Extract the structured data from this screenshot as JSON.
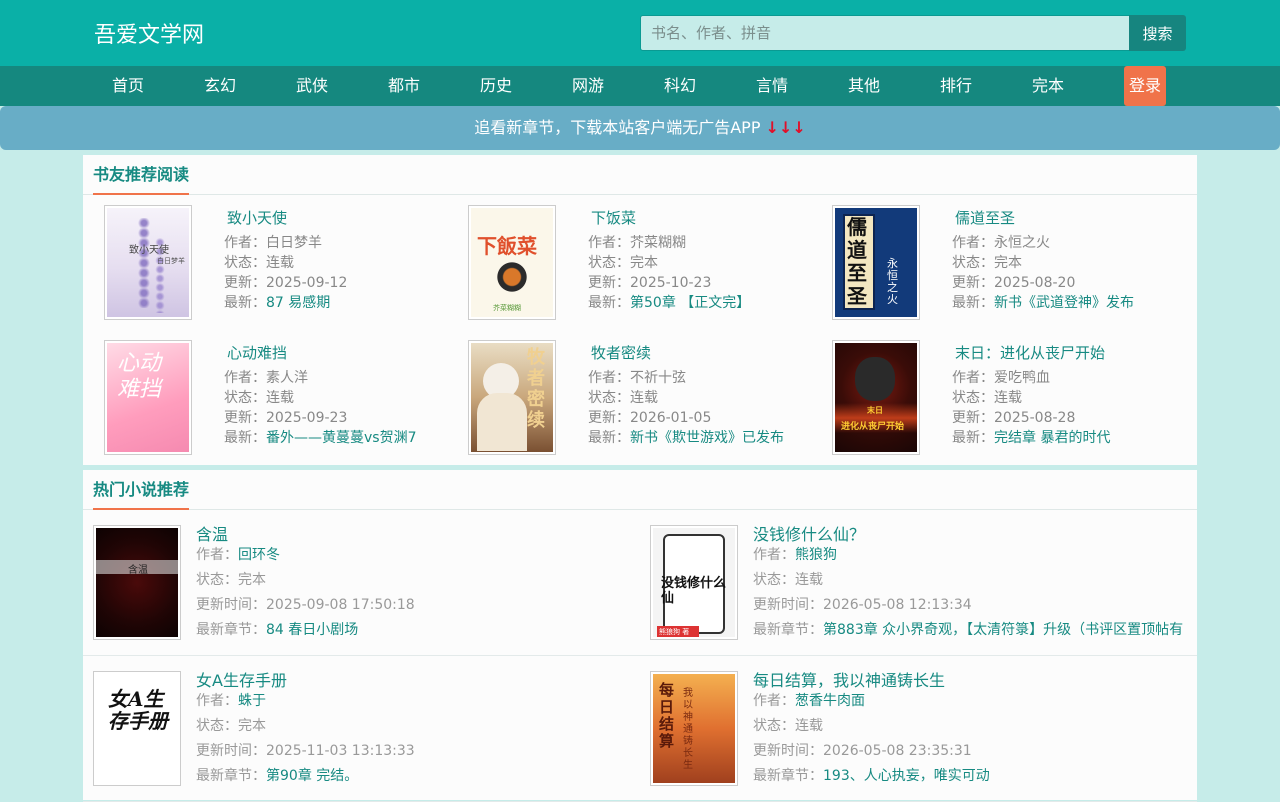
{
  "header": {
    "logo": "吾爱文学网",
    "search_placeholder": "书名、作者、拼音",
    "search_button": "搜索"
  },
  "nav": {
    "items": [
      "首页",
      "玄幻",
      "武侠",
      "都市",
      "历史",
      "网游",
      "科幻",
      "言情",
      "其他",
      "排行",
      "完本"
    ],
    "login": "登录"
  },
  "banner": {
    "text": "追看新章节，下载本站客户端无广告APP ",
    "arrows": "↓↓↓"
  },
  "recommend": {
    "title": "书友推荐阅读",
    "author_label": "作者：",
    "status_label": "状态：",
    "update_label": "更新：",
    "latest_label": "最新：",
    "books": [
      {
        "title": "致小天使",
        "author": "白日梦羊",
        "status": "连载",
        "updated": "2025-09-12",
        "latest": "87 易感期",
        "cover_text": "致小天使",
        "cover_sub": "白日梦羊"
      },
      {
        "title": "下饭菜",
        "author": "芥菜糊糊",
        "status": "完本",
        "updated": "2025-10-23",
        "latest": "第50章 【正文完】",
        "cover_text": "下飯菜",
        "cover_sub": "芥菜糊糊"
      },
      {
        "title": "儒道至圣",
        "author": "永恒之火",
        "status": "完本",
        "updated": "2025-08-20",
        "latest": "新书《武道登神》发布",
        "cover_text": "儒道至圣",
        "cover_sub": "永恒之火"
      },
      {
        "title": "心动难挡",
        "author": "素人洋",
        "status": "连载",
        "updated": "2025-09-23",
        "latest": "番外——黄蔓蔓vs贺渊7",
        "cover_text": "心动难挡",
        "cover_sub": ""
      },
      {
        "title": "牧者密续",
        "author": "不祈十弦",
        "status": "连载",
        "updated": "2026-01-05",
        "latest": "新书《欺世游戏》已发布",
        "cover_text": "牧者密续",
        "cover_sub": ""
      },
      {
        "title": "末日：进化从丧尸开始",
        "author": "爱吃鸭血",
        "status": "连载",
        "updated": "2025-08-28",
        "latest": "完结章 暴君的时代",
        "cover_text": "进化从丧尸开始",
        "cover_sub": "末日"
      }
    ]
  },
  "hot": {
    "title": "热门小说推荐",
    "author_label": "作者：",
    "status_label": "状态：",
    "update_label": "更新时间：",
    "latest_label": "最新章节：",
    "books": [
      {
        "title": "含温",
        "author": "回环冬",
        "status": "完本",
        "updated": "2025-09-08 17:50:18",
        "latest": "84 春日小剧场",
        "cover_text": "含温",
        "cover_sub": ""
      },
      {
        "title": "没钱修什么仙？",
        "author": "熊狼狗",
        "status": "连载",
        "updated": "2026-05-08 12:13:34",
        "latest": "第883章 众小界奇观，【太清符箓】升级（书评区置顶帖有",
        "cover_text": "没钱修什么仙",
        "cover_sub": "熊狼狗 著"
      },
      {
        "title": "女A生存手册",
        "author": "蛛于",
        "status": "完本",
        "updated": "2025-11-03 13:13:33",
        "latest": "第90章 完结。",
        "cover_text": "女A生存手册",
        "cover_sub": ""
      },
      {
        "title": "每日结算，我以神通铸长生",
        "author": "葱香牛肉面",
        "status": "连载",
        "updated": "2026-05-08 23:35:31",
        "latest": "193、人心执妄，唯实可动",
        "cover_text": "每日结算",
        "cover_sub": "我以神通铸长生"
      }
    ]
  },
  "colors": {
    "header": "#0ab0a7",
    "nav": "#15887f",
    "accent": "#f0734a",
    "link": "#178a82",
    "banner": "#68adc6",
    "page_bg": "#c6ece9"
  }
}
